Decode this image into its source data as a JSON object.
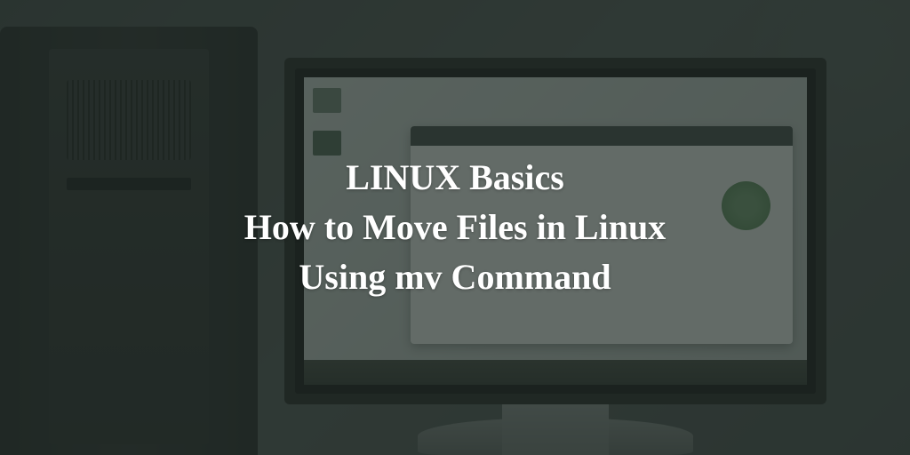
{
  "title": {
    "line1": "LINUX Basics",
    "line2": "How to Move Files in Linux",
    "line3": "Using mv Command"
  }
}
